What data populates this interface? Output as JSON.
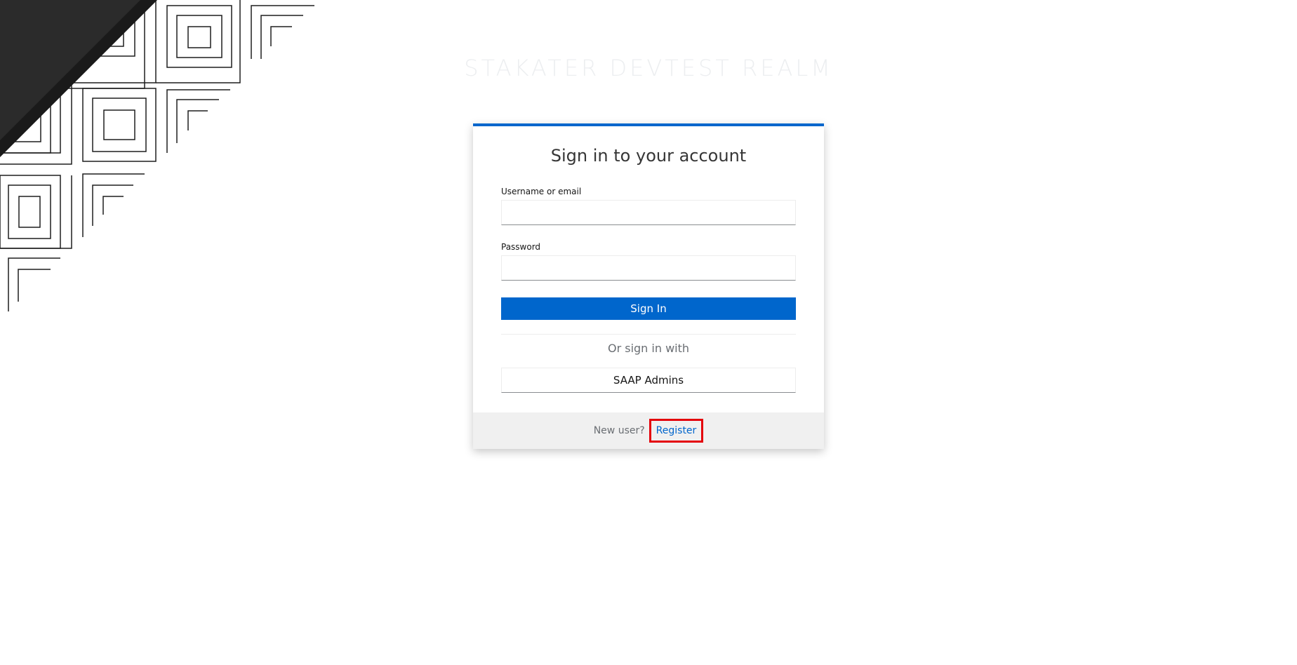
{
  "realm_title": "STAKATER DEVTEST REALM",
  "login": {
    "title": "Sign in to your account",
    "username_label": "Username or email",
    "username_value": "",
    "password_label": "Password",
    "password_value": "",
    "signin_label": "Sign In",
    "or_text": "Or sign in with",
    "provider_label": "SAAP Admins"
  },
  "footer": {
    "new_user_text": "New user?",
    "register_label": "Register"
  },
  "colors": {
    "primary": "#0066cc",
    "highlight_border": "#e4000b",
    "title_text": "#363636"
  },
  "icons": {
    "background_art": "geometric-square-pattern"
  }
}
